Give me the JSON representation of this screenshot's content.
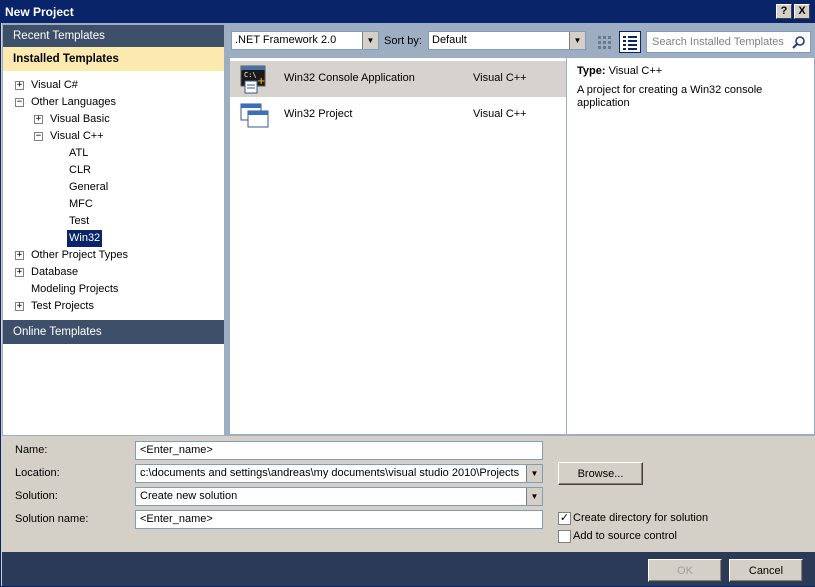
{
  "window": {
    "title": "New Project",
    "help_label": "?",
    "close_label": "X"
  },
  "sidebar": {
    "recent_label": "Recent Templates",
    "installed_label": "Installed Templates",
    "online_label": "Online Templates",
    "tree": [
      {
        "label": "Visual C#",
        "expander": "+"
      },
      {
        "label": "Other Languages",
        "expander": "−"
      },
      {
        "label": "Visual Basic",
        "expander": "+"
      },
      {
        "label": "Visual C++",
        "expander": "−"
      },
      {
        "label": "ATL"
      },
      {
        "label": "CLR"
      },
      {
        "label": "General"
      },
      {
        "label": "MFC"
      },
      {
        "label": "Test"
      },
      {
        "label": "Win32",
        "selected": true
      },
      {
        "label": "Other Project Types",
        "expander": "+"
      },
      {
        "label": "Database",
        "expander": "+"
      },
      {
        "label": "Modeling Projects"
      },
      {
        "label": "Test Projects",
        "expander": "+"
      }
    ]
  },
  "toolbar": {
    "framework_value": ".NET Framework 2.0",
    "sortby_label": "Sort by:",
    "sortby_value": "Default",
    "search_placeholder": "Search Installed Templates"
  },
  "templates": [
    {
      "name": "Win32 Console Application",
      "language": "Visual C++",
      "selected": true,
      "icon": "console-app-icon"
    },
    {
      "name": "Win32 Project",
      "language": "Visual C++",
      "selected": false,
      "icon": "win32-project-icon"
    }
  ],
  "description": {
    "type_label": "Type:",
    "type_value": "Visual C++",
    "text": "A project for creating a Win32 console application"
  },
  "form": {
    "name_label": "Name:",
    "name_value": "<Enter_name>",
    "location_label": "Location:",
    "location_value": "c:\\documents and settings\\andreas\\my documents\\visual studio 2010\\Projects",
    "solution_label": "Solution:",
    "solution_value": "Create new solution",
    "solution_name_label": "Solution name:",
    "solution_name_value": "<Enter_name>",
    "browse_label": "Browse...",
    "create_dir_label": "Create directory for solution",
    "create_dir_checked": true,
    "add_source_label": "Add to source control",
    "add_source_checked": false
  },
  "footer": {
    "ok_label": "OK",
    "cancel_label": "Cancel"
  },
  "colors": {
    "title_bar": "#0a246a",
    "section_header": "#3e5069",
    "installed_highlight": "#fbe9b0",
    "footer": "#2b3a56",
    "selection": "#0a246a"
  }
}
